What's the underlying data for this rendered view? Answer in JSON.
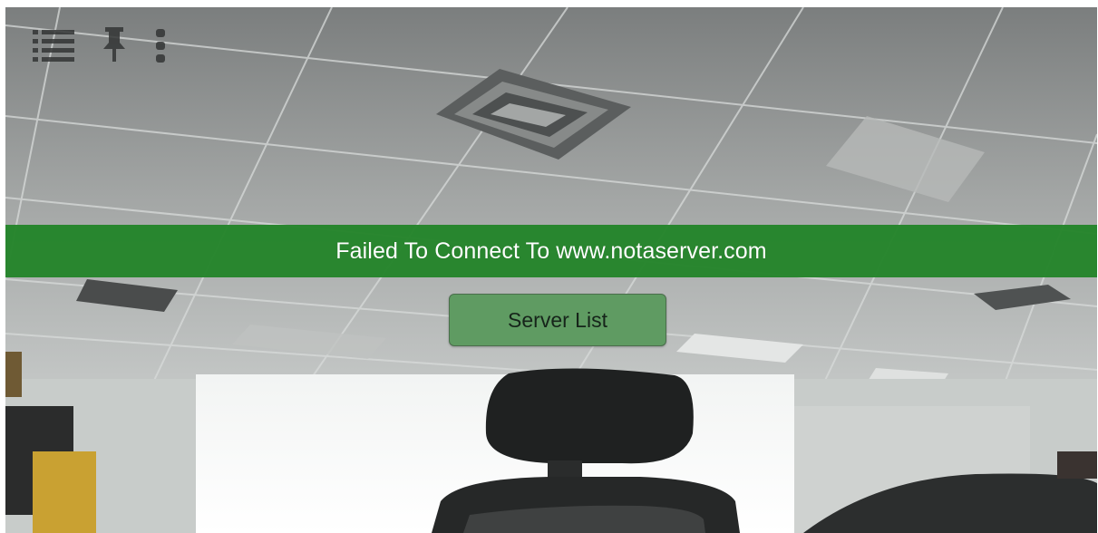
{
  "toolbar": {
    "icons": [
      "list-icon",
      "pin-icon",
      "more-vertical-icon"
    ]
  },
  "status": {
    "message": "Failed To Connect To www.notaserver.com",
    "color": "#24842a"
  },
  "server_list_button": {
    "label": "Server List",
    "color": "#5f9b62"
  }
}
